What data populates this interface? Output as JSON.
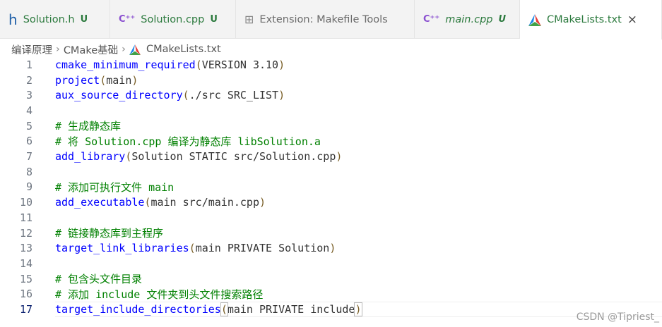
{
  "tabs": [
    {
      "label": "Solution.h",
      "status": "U",
      "icon": "h-file-icon"
    },
    {
      "label": "Solution.cpp",
      "status": "U",
      "icon": "cpp-file-icon"
    },
    {
      "label": "Extension: Makefile Tools",
      "status": "",
      "icon": "extension-icon"
    },
    {
      "label": "main.cpp",
      "status": "U",
      "icon": "cpp-file-icon"
    },
    {
      "label": "CMakeLists.txt",
      "status": "",
      "icon": "cmake-icon",
      "close": "×"
    }
  ],
  "breadcrumb": [
    "编译原理",
    "CMake基础",
    "CMakeLists.txt"
  ],
  "breadcrumb_sep": "›",
  "code": {
    "current_line": 17,
    "lines": [
      {
        "n": "1",
        "t": "cmake_minimum_required(VERSION 3.10)"
      },
      {
        "n": "2",
        "t": "project(main)"
      },
      {
        "n": "3",
        "t": "aux_source_directory(./src SRC_LIST)"
      },
      {
        "n": "4",
        "t": ""
      },
      {
        "n": "5",
        "t": "# 生成静态库"
      },
      {
        "n": "6",
        "t": "# 将 Solution.cpp 编译为静态库 libSolution.a"
      },
      {
        "n": "7",
        "t": "add_library(Solution STATIC src/Solution.cpp)"
      },
      {
        "n": "8",
        "t": ""
      },
      {
        "n": "9",
        "t": "# 添加可执行文件 main"
      },
      {
        "n": "10",
        "t": "add_executable(main src/main.cpp)"
      },
      {
        "n": "11",
        "t": ""
      },
      {
        "n": "12",
        "t": "# 链接静态库到主程序"
      },
      {
        "n": "13",
        "t": "target_link_libraries(main PRIVATE Solution)"
      },
      {
        "n": "14",
        "t": ""
      },
      {
        "n": "15",
        "t": "# 包含头文件目录"
      },
      {
        "n": "16",
        "t": "# 添加 include 文件夹到头文件搜索路径"
      },
      {
        "n": "17",
        "t": "target_include_directories(main PRIVATE include)"
      }
    ]
  },
  "watermark": "CSDN @Tipriest_",
  "colors": {
    "modified": "#2c7a3e",
    "function": "#0000ff",
    "comment": "#008000",
    "paren": "#795e26"
  }
}
